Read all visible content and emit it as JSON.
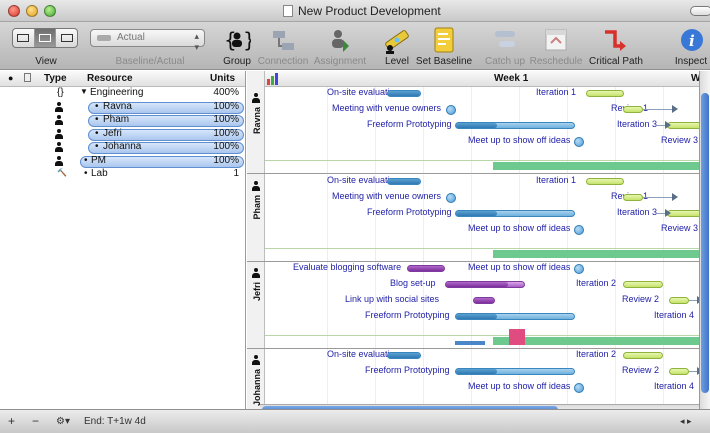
{
  "window": {
    "title": "New Product Development"
  },
  "toolbar": {
    "view_label": "View",
    "baseline_value": "Actual",
    "baseline_label": "Baseline/Actual",
    "buttons": [
      {
        "id": "group",
        "label": "Group",
        "enabled": true
      },
      {
        "id": "connection",
        "label": "Connection",
        "enabled": false
      },
      {
        "id": "assignment",
        "label": "Assignment",
        "enabled": false
      },
      {
        "id": "level",
        "label": "Level",
        "enabled": true
      },
      {
        "id": "set-baseline",
        "label": "Set Baseline",
        "enabled": true
      },
      {
        "id": "catch-up",
        "label": "Catch up",
        "enabled": false
      },
      {
        "id": "reschedule",
        "label": "Reschedule",
        "enabled": false
      },
      {
        "id": "critical-path",
        "label": "Critical Path",
        "enabled": true
      },
      {
        "id": "inspect",
        "label": "Inspect",
        "enabled": true
      }
    ]
  },
  "outline": {
    "headers": {
      "type": "Type",
      "resource": "Resource",
      "units": "Units"
    },
    "rows": [
      {
        "type": "{}",
        "name": "Engineering",
        "units": "400%",
        "disclosure": "▼",
        "selected": false
      },
      {
        "type": "person",
        "name": "Ravna",
        "units": "100%",
        "selected": true
      },
      {
        "type": "person",
        "name": "Pham",
        "units": "100%",
        "selected": true
      },
      {
        "type": "person",
        "name": "Jefri",
        "units": "100%",
        "selected": true
      },
      {
        "type": "person",
        "name": "Johanna",
        "units": "100%",
        "selected": true
      },
      {
        "type": "person",
        "name": "PM",
        "units": "100%",
        "selected": true
      },
      {
        "type": "material",
        "name": "Lab",
        "units": "1",
        "selected": false
      }
    ]
  },
  "footer": {
    "add": "+",
    "remove": "−",
    "action": "⚙▾",
    "end_label": "End: T+1w 4d"
  },
  "gantt": {
    "header": "Week 1",
    "header_right": "W",
    "lanes": [
      {
        "name": "Ravna",
        "tasks": [
          {
            "label": "On-site evaluation"
          },
          {
            "label": "Meeting with venue owners"
          },
          {
            "label": "Freeform Prototyping"
          },
          {
            "label": "Meet up to show off ideas"
          },
          {
            "label": "Iteration 1"
          },
          {
            "label": "Review 1"
          },
          {
            "label": "Iteration 3"
          },
          {
            "label": "Review 3"
          }
        ]
      },
      {
        "name": "Pham",
        "tasks": [
          {
            "label": "On-site evaluation"
          },
          {
            "label": "Meeting with venue owners"
          },
          {
            "label": "Freeform Prototyping"
          },
          {
            "label": "Meet up to show off ideas"
          },
          {
            "label": "Iteration 1"
          },
          {
            "label": "Review 1"
          },
          {
            "label": "Iteration 3"
          },
          {
            "label": "Review 3"
          }
        ]
      },
      {
        "name": "Jefri",
        "tasks": [
          {
            "label": "Evaluate blogging software"
          },
          {
            "label": "Blog set-up"
          },
          {
            "label": "Link up with social sites"
          },
          {
            "label": "Freeform Prototyping"
          },
          {
            "label": "Meet up to show off ideas"
          },
          {
            "label": "Iteration 2"
          },
          {
            "label": "Review 2"
          },
          {
            "label": "Iteration 4"
          }
        ]
      },
      {
        "name": "Johanna",
        "tasks": [
          {
            "label": "On-site evaluation"
          },
          {
            "label": "Freeform Prototyping"
          },
          {
            "label": "Meet up to show off ideas"
          },
          {
            "label": "Iteration 2"
          },
          {
            "label": "Review 2"
          },
          {
            "label": "Iteration 4"
          }
        ]
      }
    ]
  }
}
